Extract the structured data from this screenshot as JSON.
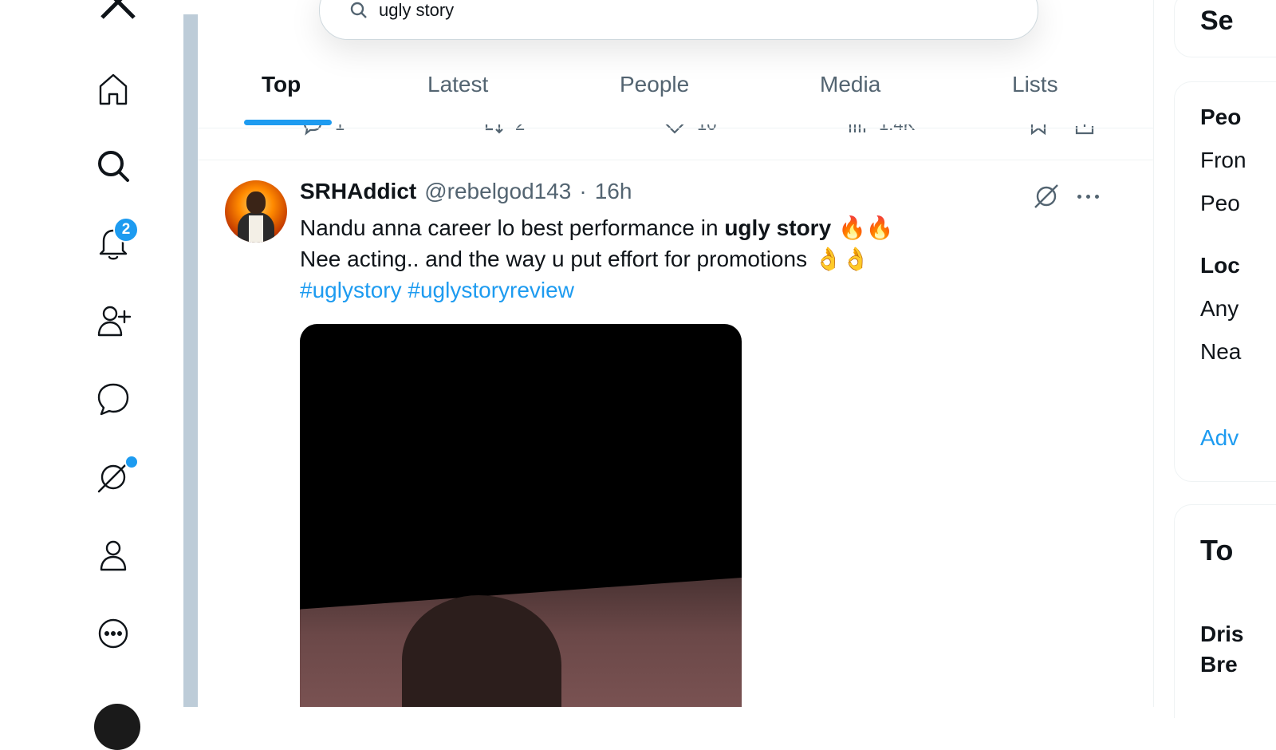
{
  "search": {
    "value": "ugly story"
  },
  "tabs": [
    {
      "label": "Top",
      "active": true
    },
    {
      "label": "Latest",
      "active": false
    },
    {
      "label": "People",
      "active": false
    },
    {
      "label": "Media",
      "active": false
    },
    {
      "label": "Lists",
      "active": false
    }
  ],
  "nav": {
    "notifications_badge": "2",
    "icons": [
      "x-logo-icon",
      "home-icon",
      "search-icon",
      "bell-icon",
      "follow-icon",
      "messages-icon",
      "grok-icon",
      "profile-icon",
      "more-icon"
    ]
  },
  "prev_tweet_actions": {
    "replies": "1",
    "reposts": "2",
    "likes": "10",
    "views": "1.4K"
  },
  "tweet": {
    "name": "SRHAddict",
    "handle": "@rebelgod143",
    "sep": "·",
    "time": "16h",
    "line1_prefix": "Nandu anna career lo best performance in ",
    "line1_bold": "ugly story",
    "line1_emoji": " 🔥🔥",
    "line2": "Nee acting.. and the way u put effort for promotions",
    "line2_emoji": " 👌👌",
    "hashtag1": "#uglystory",
    "hashtag2": "#uglystoryreview"
  },
  "right": {
    "title_partial": "Se",
    "people_header": "Peo",
    "people_opt1": "Fron",
    "people_opt2": "Peo",
    "location_header": "Loc",
    "location_opt1": "Any",
    "location_opt2": "Nea",
    "advanced": "Adv",
    "trends_title": "To",
    "trend1_line1": "Dris",
    "trend1_line2": "Bre"
  },
  "colors": {
    "accent": "#1d9bf0",
    "text": "#0f1419",
    "muted": "#536471",
    "divider": "#bdccd8"
  }
}
